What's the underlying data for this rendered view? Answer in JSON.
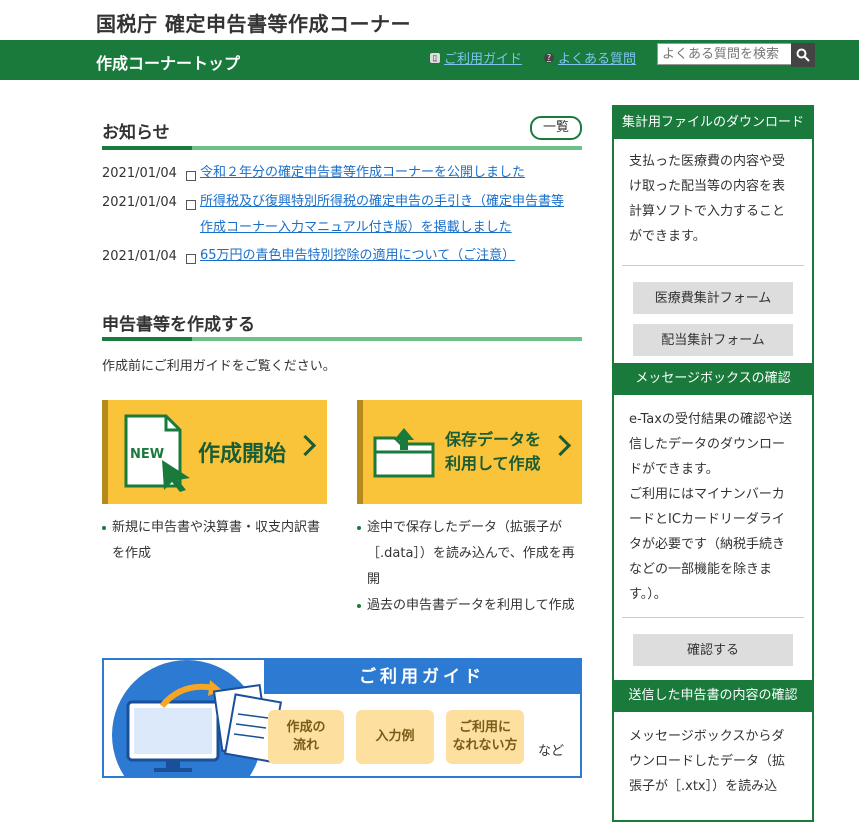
{
  "header": {
    "site_title": "国税庁 確定申告書等作成コーナー",
    "bar_title": "作成コーナートップ",
    "guide_link": "ご利用ガイド",
    "faq_link": "よくある質問",
    "search_placeholder": "よくある質問を検索"
  },
  "news": {
    "heading": "お知らせ",
    "list_button": "一覧",
    "items": [
      {
        "date": "2021/01/04",
        "text": "令和２年分の確定申告書等作成コーナーを公開しました"
      },
      {
        "date": "2021/01/04",
        "text": "所得税及び復興特別所得税の確定申告の手引き（確定申告書等作成コーナー入力マニュアル付き版）を掲載しました"
      },
      {
        "date": "2021/01/04",
        "text": "65万円の青色申告特別控除の適用について（ご注意）"
      }
    ]
  },
  "create": {
    "heading": "申告書等を作成する",
    "intro": "作成前にご利用ガイドをご覧ください。",
    "new_card": {
      "badge": "NEW",
      "label": "作成開始"
    },
    "saved_card": {
      "label_line1": "保存データを",
      "label_line2": "利用して作成"
    },
    "new_bullets": [
      "新規に申告書や決算書・収支内訳書を作成"
    ],
    "saved_bullets": [
      "途中で保存したデータ（拡張子が［.data］）を読み込んで、作成を再開",
      "過去の申告書データを利用して作成"
    ]
  },
  "guide": {
    "title": "ご利用ガイド",
    "pill1_line1": "作成の",
    "pill1_line2": "流れ",
    "pill2": "入力例",
    "pill3_line1": "ご利用に",
    "pill3_line2": "なれない方",
    "etc": "など"
  },
  "sidebar": {
    "download": {
      "heading": "集計用ファイルのダウンロード",
      "text": "支払った医療費の内容や受け取った配当等の内容を表計算ソフトで入力することができます。",
      "button1": "医療費集計フォーム",
      "button2": "配当集計フォーム"
    },
    "message_box": {
      "heading": "メッセージボックスの確認",
      "text1": "e-Taxの受付結果の確認や送信したデータのダウンロードができます。",
      "text2": "ご利用にはマイナンバーカードとICカードリーダライタが必要です（納税手続きなどの一部機能を除きます。）。",
      "button": "確認する"
    },
    "sent": {
      "heading": "送信した申告書の内容の確認",
      "text": "メッセージボックスからダウンロードしたデータ（拡張子が［.xtx］）を読み込"
    }
  },
  "colors": {
    "brand_green": "#1a7a3c",
    "card_yellow": "#f9c33a",
    "guide_blue": "#2d7ad3",
    "link_blue": "#1a6fc9"
  }
}
